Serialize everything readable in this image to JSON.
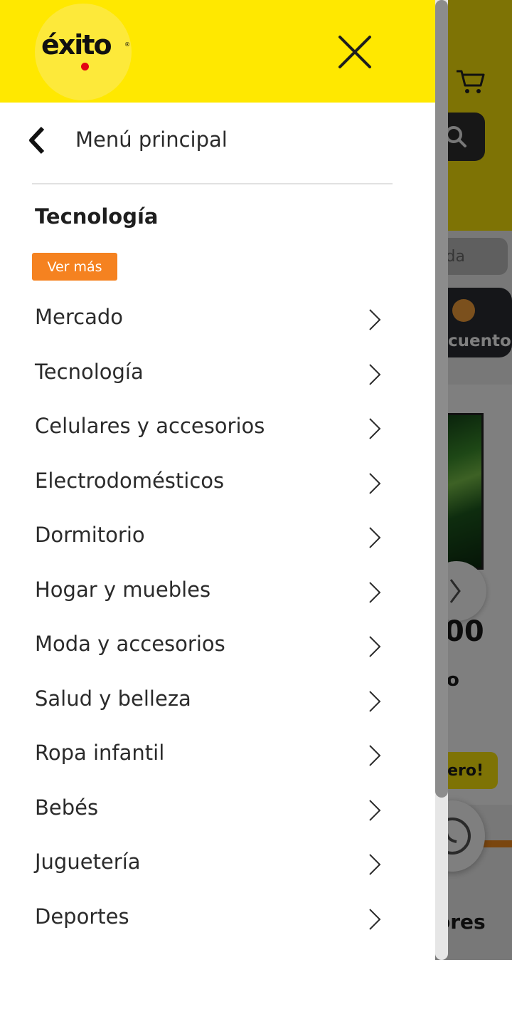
{
  "brand": {
    "logo_text": "éxito",
    "accent_color": "#ffe800",
    "cta_color": "#f58220"
  },
  "drawer": {
    "close_icon": "close-icon",
    "back_label": "Menú principal",
    "section_title": "Tecnología",
    "see_more_label": "Ver más",
    "items": [
      {
        "label": "Mercado"
      },
      {
        "label": "Tecnología"
      },
      {
        "label": "Celulares y accesorios"
      },
      {
        "label": "Electrodomésticos"
      },
      {
        "label": "Dormitorio"
      },
      {
        "label": "Hogar y muebles"
      },
      {
        "label": "Moda y accesorios"
      },
      {
        "label": "Salud y belleza"
      },
      {
        "label": "Ropa infantil"
      },
      {
        "label": "Bebés"
      },
      {
        "label": "Juguetería"
      },
      {
        "label": "Deportes"
      }
    ]
  },
  "background": {
    "chip_text": "da",
    "banner_text": "cuento",
    "price_fragment": "00",
    "small_fragment": "o",
    "cta_fragment": "iero!",
    "bottom_fragment": "ores"
  }
}
